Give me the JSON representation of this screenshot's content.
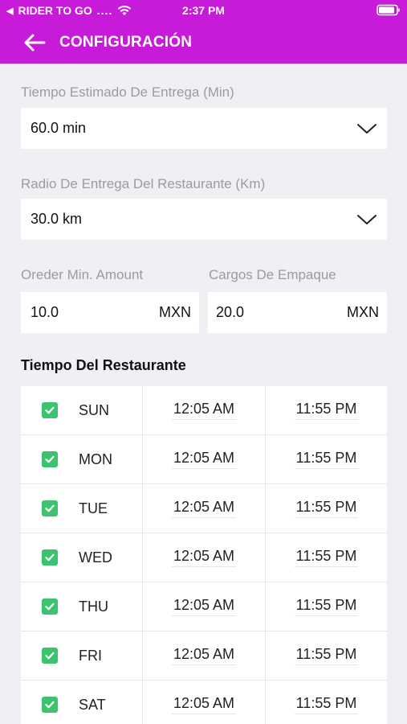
{
  "status_bar": {
    "carrier": "RIDER TO GO",
    "dots": "....",
    "time": "2:37 PM"
  },
  "header": {
    "title": "CONFIGURACIÓN"
  },
  "delivery_time": {
    "label": "Tiempo Estimado De Entrega (Min)",
    "value": "60.0 min"
  },
  "delivery_radius": {
    "label": "Radio De Entrega Del Restaurante (Km)",
    "value": "30.0 km"
  },
  "min_amount": {
    "label": "Oreder Min. Amount",
    "value": "10.0",
    "unit": "MXN"
  },
  "packing_charges": {
    "label": "Cargos De Empaque",
    "value": "20.0",
    "unit": "MXN"
  },
  "schedule": {
    "title": "Tiempo Del Restaurante",
    "rows": [
      {
        "day": "SUN",
        "open": "12:05 AM",
        "close": "11:55 PM",
        "checked": true
      },
      {
        "day": "MON",
        "open": "12:05 AM",
        "close": "11:55 PM",
        "checked": true
      },
      {
        "day": "TUE",
        "open": "12:05 AM",
        "close": "11:55 PM",
        "checked": true
      },
      {
        "day": "WED",
        "open": "12:05 AM",
        "close": "11:55 PM",
        "checked": true
      },
      {
        "day": "THU",
        "open": "12:05 AM",
        "close": "11:55 PM",
        "checked": true
      },
      {
        "day": "FRI",
        "open": "12:05 AM",
        "close": "11:55 PM",
        "checked": true
      },
      {
        "day": "SAT",
        "open": "12:05 AM",
        "close": "11:55 PM",
        "checked": true
      }
    ]
  },
  "colors": {
    "accent": "#c81ad9",
    "check": "#3bc46d",
    "background": "#efeff4"
  }
}
